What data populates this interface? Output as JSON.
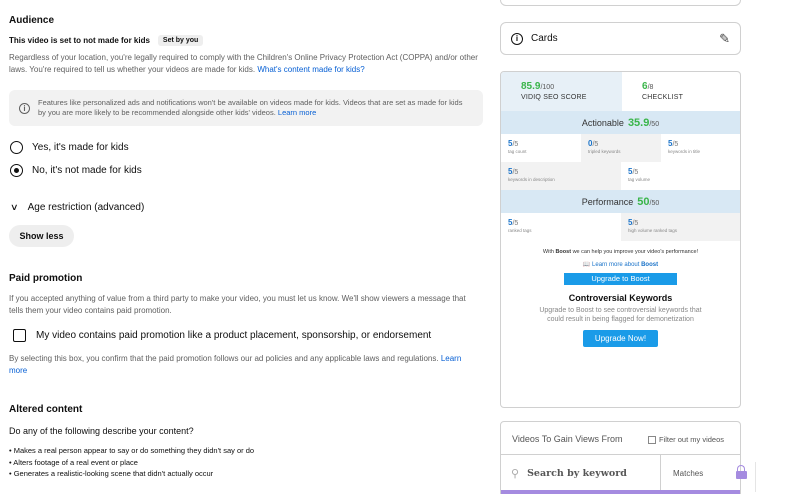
{
  "audience": {
    "title": "Audience",
    "set_text": "This video is set to not made for kids",
    "set_badge": "Set by you",
    "coppa_text": "Regardless of your location, you're legally required to comply with the Children's Online Privacy Protection Act (COPPA) and/or other laws. You're required to tell us whether your videos are made for kids.",
    "coppa_link": "What's content made for kids?",
    "info_icon": "info-icon",
    "info_text": "Features like personalized ads and notifications won't be available on videos made for kids. Videos that are set as made for kids by you are more likely to be recommended alongside other kids' videos.",
    "info_link": "Learn more",
    "radio_yes": "Yes, it's made for kids",
    "radio_no": "No, it's not made for kids",
    "selected": "no"
  },
  "age_restriction": {
    "label": "Age restriction (advanced)",
    "icon": "chevron-down-icon"
  },
  "show_less_label": "Show less",
  "paid_promotion": {
    "title": "Paid promotion",
    "text": "If you accepted anything of value from a third party to make your video, you must let us know. We'll show viewers a message that tells them your video contains paid promotion.",
    "checkbox_label": "My video contains paid promotion like a product placement, sponsorship, or endorsement",
    "checked": false,
    "select_text": "By selecting this box, you confirm that the paid promotion follows our ad policies and any applicable laws and regulations.",
    "select_link": "Learn more"
  },
  "altered_content": {
    "title": "Altered content",
    "question": "Do any of the following describe your content?",
    "bullets": [
      "Makes a real person appear to say or do something they didn't say or do",
      "Alters footage of a real event or place",
      "Generates a realistic-looking scene that didn't actually occur"
    ]
  },
  "cards": {
    "label": "Cards",
    "icon": "info-icon",
    "edit_icon": "pencil-icon"
  },
  "vidiq": {
    "seo_score": "85.9",
    "seo_max": "/100",
    "seo_label": "VIDIQ SEO SCORE",
    "checklist_score": "6",
    "checklist_max": "/8",
    "checklist_label": "CHECKLIST",
    "actionable_label": "Actionable",
    "actionable_score": "35.9",
    "actionable_max": "/50",
    "actionable_items": [
      {
        "v": "5",
        "max": "/5",
        "label": "tag count"
      },
      {
        "v": "0",
        "max": "/5",
        "label": "tripled keywords"
      },
      {
        "v": "5",
        "max": "/5",
        "label": "keywords in title"
      },
      {
        "v": "5",
        "max": "/5",
        "label": "keywords in description"
      },
      {
        "v": "5",
        "max": "/5",
        "label": "tag volume"
      }
    ],
    "performance_label": "Performance",
    "performance_score": "50",
    "performance_max": "/50",
    "performance_items": [
      {
        "v": "5",
        "max": "/5",
        "label": "ranked tags"
      },
      {
        "v": "5",
        "max": "/5",
        "label": "high volume ranked tags"
      }
    ],
    "boost_pre": "With",
    "boost_brand": "Boost",
    "boost_post": "we can help you improve your video's performance!",
    "learn_more_prefix": "Learn more about",
    "learn_more_brand": "Boost",
    "upgrade_label": "Upgrade to Boost",
    "controversial_title": "Controversial Keywords",
    "controversial_text": "Upgrade to Boost to see controversial keywords that could result in being flagged for demonetization",
    "upgrade_now_label": "Upgrade Now!"
  },
  "gain_views": {
    "title": "Videos To Gain Views From",
    "filter_label": "Filter out my videos",
    "search_placeholder": "Search by keyword",
    "matches_label": "Matches",
    "lock_icon": "lock-icon"
  },
  "colors": {
    "link": "#065fd4",
    "vidiq_green": "#3ab54a",
    "vidiq_blue": "#1a9be8",
    "band": "#d8e8f4",
    "lock_purple": "#a58be0"
  }
}
